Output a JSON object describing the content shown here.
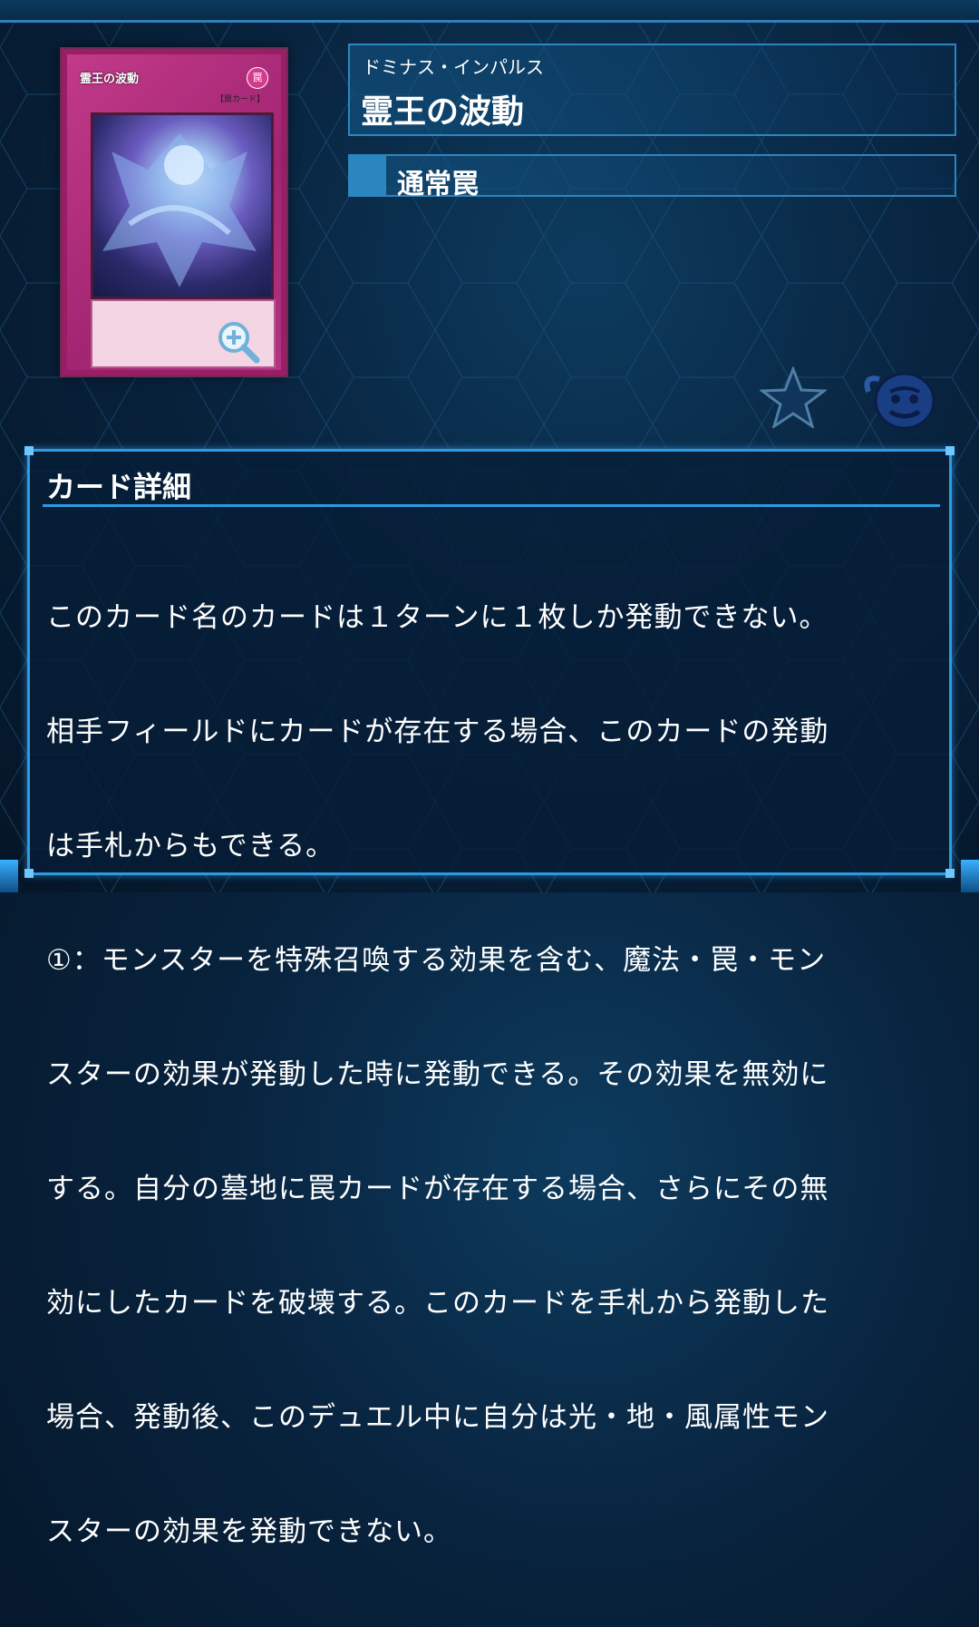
{
  "card": {
    "name": "霊王の波動",
    "ruby": "ドミナス・インパルス",
    "type": "通常罠",
    "image_label": "霊王の波動",
    "image_attribute": "罠",
    "image_type_line": "【罠カード】"
  },
  "detail": {
    "heading": "カード詳細",
    "text_lines": [
      "このカード名のカードは１ターンに１枚しか発動できない。",
      "相手フィールドにカードが存在する場合、このカードの発動",
      "は手札からもできる。",
      "①：モンスターを特殊召喚する効果を含む、魔法・罠・モン",
      "スターの効果が発動した時に発動できる。その効果を無効に",
      "する。自分の墓地に罠カードが存在する場合、さらにその無",
      "効にしたカードを破壊する。このカードを手札から発動した",
      "場合、発動後、このデュエル中に自分は光・地・風属性モン",
      "スターの効果を発動できない。"
    ]
  },
  "icons": {
    "zoom": "zoom-in-icon",
    "favorite": "star-icon",
    "pot": "pot-of-greed-icon"
  },
  "colors": {
    "accent": "#2d9be0",
    "card_frame": "#9a1e66",
    "background": "#08233e"
  }
}
